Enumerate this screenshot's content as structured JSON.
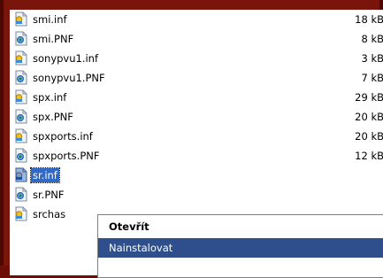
{
  "files": [
    {
      "name": "smi.inf",
      "size": "18 kB",
      "type": "inf"
    },
    {
      "name": "smi.PNF",
      "size": "8 kB",
      "type": "pnf"
    },
    {
      "name": "sonypvu1.inf",
      "size": "3 kB",
      "type": "inf"
    },
    {
      "name": "sonypvu1.PNF",
      "size": "7 kB",
      "type": "pnf"
    },
    {
      "name": "spx.inf",
      "size": "29 kB",
      "type": "inf"
    },
    {
      "name": "spx.PNF",
      "size": "20 kB",
      "type": "pnf"
    },
    {
      "name": "spxports.inf",
      "size": "20 kB",
      "type": "inf"
    },
    {
      "name": "spxports.PNF",
      "size": "12 kB",
      "type": "pnf"
    },
    {
      "name": "sr.inf",
      "size": "",
      "type": "inf",
      "selected": true
    },
    {
      "name": "sr.PNF",
      "size": "",
      "type": "pnf"
    },
    {
      "name": "srchas",
      "size": "",
      "type": "inf"
    }
  ],
  "context_menu": {
    "items": [
      {
        "label": "Otevřít",
        "bold": true
      },
      {
        "label": "Nainstalovat",
        "highlighted": true
      }
    ]
  },
  "icons": {
    "inf": "inf-settings-file-icon",
    "pnf": "pnf-precompiled-file-icon"
  },
  "colors": {
    "selection": "#316ac5",
    "menu_highlight": "#2e4f8c",
    "frame": "#7a150b"
  }
}
